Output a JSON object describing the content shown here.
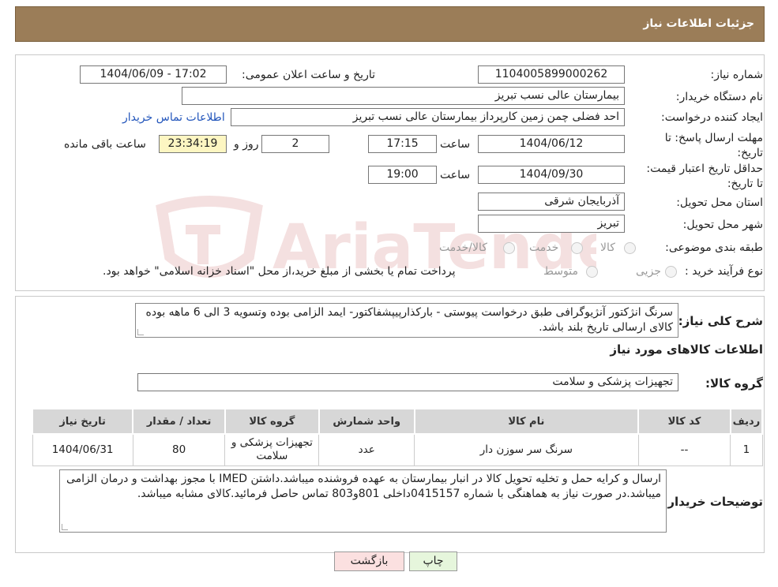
{
  "header": {
    "title": "جزئیات اطلاعات نیاز"
  },
  "watermark": {
    "text": "AriaTender.neT"
  },
  "form": {
    "need_number": {
      "label": "شماره نیاز:",
      "value": "1104005899000262"
    },
    "announce": {
      "label": "تاریخ و ساعت اعلان عمومی:",
      "value": "1404/06/09 - 17:02"
    },
    "buyer": {
      "label": "نام دستگاه خریدار:",
      "value": "بیمارستان عالی نسب تبریز"
    },
    "creator": {
      "label": "ایجاد کننده درخواست:",
      "value": "احد فضلی چمن زمین کارپرداز  بیمارستان عالی نسب تبریز",
      "contact_link": "اطلاعات تماس خریدار"
    },
    "deadline": {
      "label": "مهلت ارسال پاسخ: تا تاریخ:",
      "date": "1404/06/12",
      "time_label": "ساعت",
      "time": "17:15",
      "days": "2",
      "days_label": "روز و",
      "remaining": "23:34:19",
      "remaining_label": "ساعت باقی مانده"
    },
    "validity": {
      "label": "حداقل تاریخ اعتبار قیمت: تا تاریخ:",
      "date": "1404/09/30",
      "time_label": "ساعت",
      "time": "19:00"
    },
    "province": {
      "label": "استان محل تحویل:",
      "value": "آذربایجان شرقی"
    },
    "city": {
      "label": "شهر محل تحویل:",
      "value": "تبریز"
    },
    "category": {
      "label": "طبقه بندی موضوعی:",
      "options": [
        "کالا",
        "خدمت",
        "کالا/خدمت"
      ]
    },
    "purchase_type": {
      "label": "نوع فرآیند خرید :",
      "options": [
        "جزیی",
        "متوسط"
      ],
      "note": "پرداخت تمام یا بخشی از مبلغ خرید،از محل \"اسناد خزانه اسلامی\" خواهد بود."
    }
  },
  "summary": {
    "label": "شرح کلی نیاز:",
    "text": "سرنگ انژکتور آنژیوگرافی طبق درخواست پیوستی - بارکذارپیپشفاکتور- ایمد الزامی بوده وتسویه 3 الی 6 ماهه بوده کالای ارسالی تاریخ بلند باشد."
  },
  "goods_section": {
    "title": "اطلاعات کالاهای مورد نیاز",
    "group_label": "گروه کالا:",
    "group_value": "تجهیزات پزشکی و سلامت"
  },
  "table": {
    "headers": [
      "ردیف",
      "کد کالا",
      "نام کالا",
      "واحد شمارش",
      "گروه کالا",
      "تعداد / مقدار",
      "تاریخ نیاز"
    ],
    "rows": [
      [
        "1",
        "--",
        "سرنگ سر سوزن دار",
        "عدد",
        "تجهیزات پزشکی و سلامت",
        "80",
        "1404/06/31"
      ]
    ]
  },
  "buyer_notes": {
    "label": "توضیحات خریدار:",
    "text": "ارسال و کرایه حمل و تخلیه  تحویل کالا در انبار بیمارستان به عهده فروشنده میباشد.داشتن IMED با مجوز بهداشت و درمان الزامی میباشد.در صورت نیاز به هماهنگی با شماره 0415157داخلی 801و803 تماس حاصل فرمائید.کالای مشابه میباشد."
  },
  "buttons": {
    "print": "چاپ",
    "back": "بازگشت"
  },
  "colors": {
    "header": "#9b7d58",
    "back_button": "#fbe0e0",
    "print_button": "#e6f6dc",
    "remaining_box": "#fdf6c2"
  }
}
